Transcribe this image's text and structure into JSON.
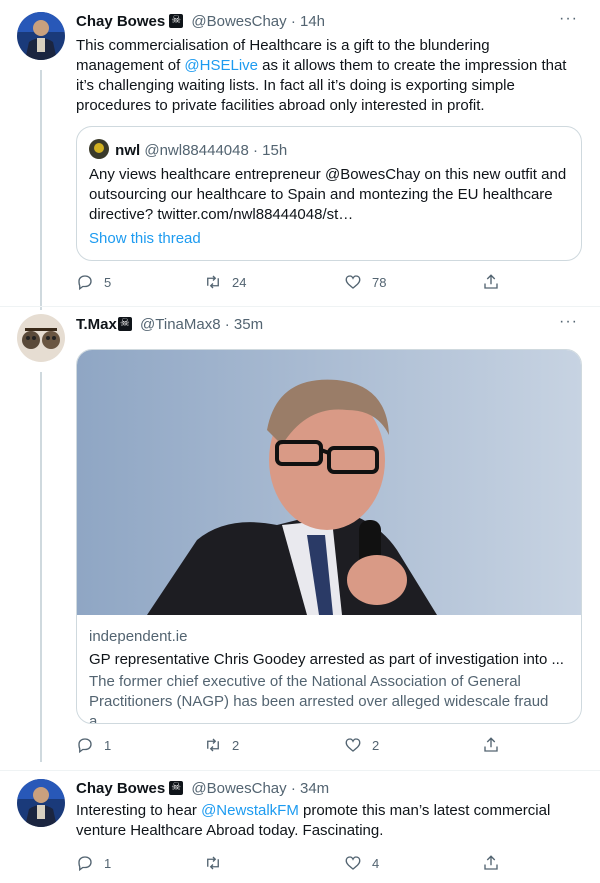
{
  "tweets": [
    {
      "name": "Chay Bowes",
      "handle": "@BowesChay",
      "time": "· 14h",
      "text_pre": "This commercialisation of Healthcare is a gift to the blundering management of ",
      "mention": "@HSELive",
      "text_post": " as it allows them to create the impression that it’s challenging waiting lists. In fact all it’s doing is exporting simple procedures to private facilities abroad only interested in profit.",
      "quote": {
        "name": "nwl",
        "handle": "@nwl88444048",
        "time": "· 15h",
        "text": "Any views healthcare entrepreneur @BowesChay on this new outfit and outsourcing our healthcare to Spain and montezing the EU healthcare directive? twitter.com/nwl88444048/st…",
        "show_thread": "Show this thread"
      },
      "replies": "5",
      "retweets": "24",
      "likes": "78"
    },
    {
      "name": "T.Max",
      "handle": "@TinaMax8",
      "time": "· 35m",
      "card": {
        "domain": "independent.ie",
        "title": "GP representative Chris Goodey arrested as part of investigation into ...",
        "description": "The former chief executive of the National Association of General Practitioners (NAGP) has been arrested over alleged widescale fraud a..."
      },
      "replies": "1",
      "retweets": "2",
      "likes": "2"
    },
    {
      "name": "Chay Bowes",
      "handle": "@BowesChay",
      "time": "· 34m",
      "text_pre": "Interesting to hear ",
      "mention": "@NewstalkFM",
      "text_post": " promote this man’s latest commercial venture Healthcare Abroad today. Fascinating.",
      "replies": "1",
      "retweets": "",
      "likes": "4"
    }
  ],
  "colors": {
    "accent": "#1d9bf0",
    "muted": "#536471",
    "border": "#cfd9de"
  }
}
